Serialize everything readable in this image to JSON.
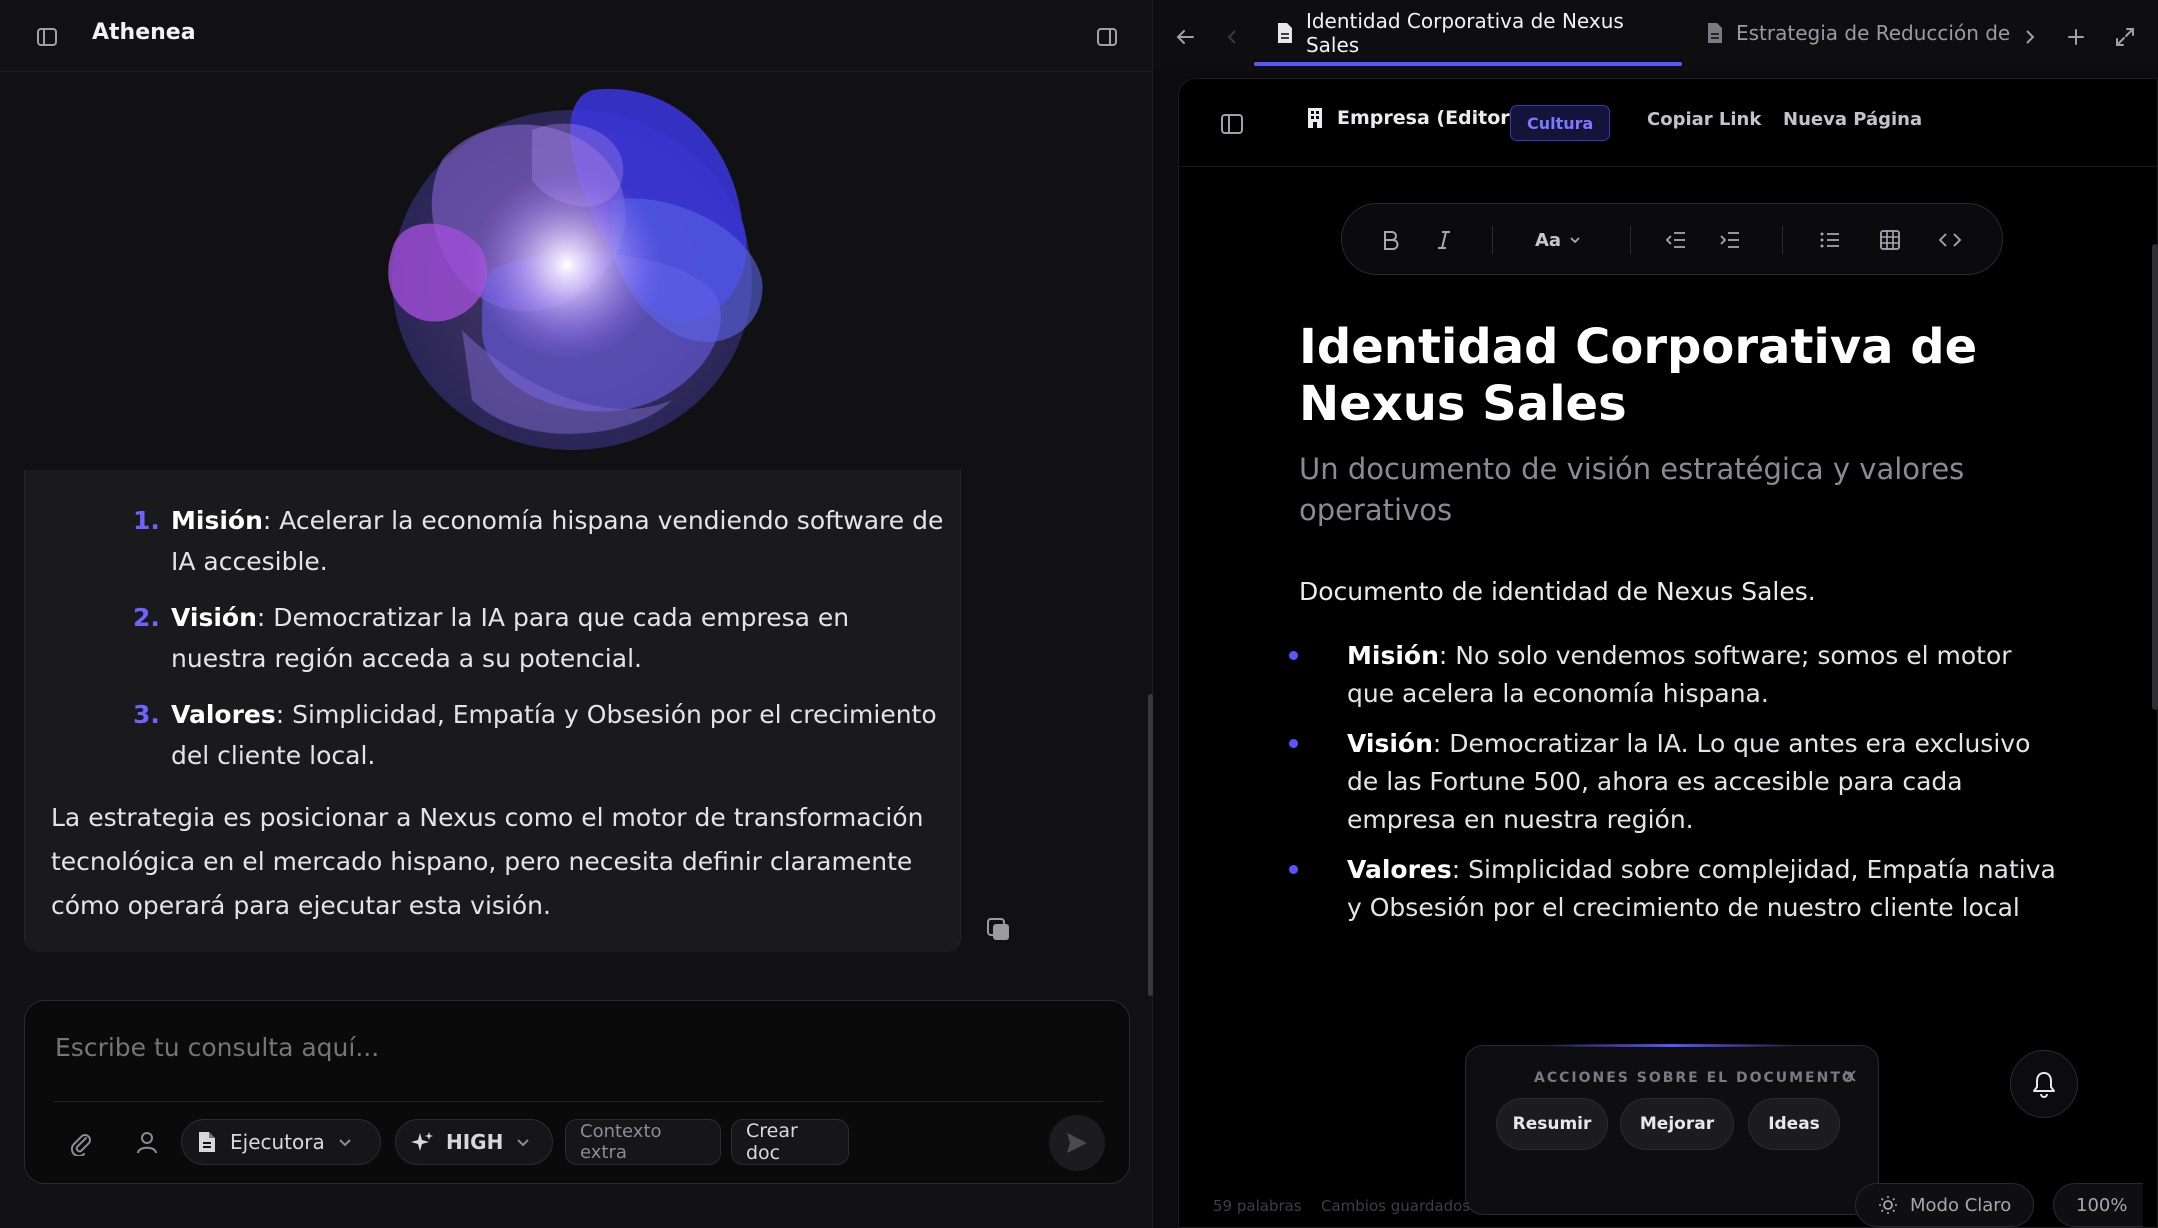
{
  "app": {
    "title": "Athenea"
  },
  "chat": {
    "mission_items": [
      {
        "num": "1.",
        "label": "Misión",
        "text": ": Acelerar la economía hispana vendiendo software de IA accesible."
      },
      {
        "num": "2.",
        "label": "Visión",
        "text": ": Democratizar la IA para que cada empresa en nuestra región acceda a su potencial."
      },
      {
        "num": "3.",
        "label": "Valores",
        "text": ": Simplicidad, Empatía y Obsesión por el crecimiento del cliente local."
      }
    ],
    "paragraph": "La estrategia es posicionar a Nexus como el motor de transformación tecnológica en el mercado hispano, pero necesita definir claramente cómo operará para ejecutar esta visión."
  },
  "composer": {
    "placeholder": "Escribe tu consulta aquí...",
    "mode": "Ejecutora",
    "level": "HIGH",
    "context_label": "Contexto extra",
    "create_label": "Crear doc"
  },
  "tabs": {
    "active": "Identidad Corporativa de Nexus Sales",
    "inactive": "Estrategia de Reducción de Errores"
  },
  "doc_header": {
    "crumb": "Empresa (Editor)",
    "badge": "Cultura",
    "copy_link": "Copiar Link",
    "new_page": "Nueva Página"
  },
  "toolbar": {
    "font_size_label": "Aa"
  },
  "document": {
    "title": "Identidad Corporativa de Nexus Sales",
    "subtitle": "Un documento de visión estratégica y valores operativos",
    "intro": "Documento de identidad de Nexus Sales.",
    "bullets": [
      {
        "label": "Misión",
        "text": ": No solo vendemos software; somos el motor que acelera la economía hispana."
      },
      {
        "label": "Visión",
        "text": ": Democratizar la IA. Lo que antes era exclusivo de las Fortune 500, ahora es accesible para cada empresa en nuestra región."
      },
      {
        "label": "Valores",
        "text": ": Simplicidad sobre complejidad, Empatía nativa y Obsesión por el crecimiento de nuestro cliente local"
      }
    ]
  },
  "actions": {
    "title": "ACCIONES SOBRE EL DOCUMENTO",
    "summarize": "Resumir",
    "improve": "Mejorar",
    "ideas": "Ideas"
  },
  "status": {
    "words": "59 palabras",
    "saved": "Cambios guardados",
    "mode_label": "Modo Claro",
    "zoom": "100%"
  },
  "colors": {
    "accent": "#5a55ff",
    "accent_text": "#6e63ff",
    "background": "#000000"
  }
}
